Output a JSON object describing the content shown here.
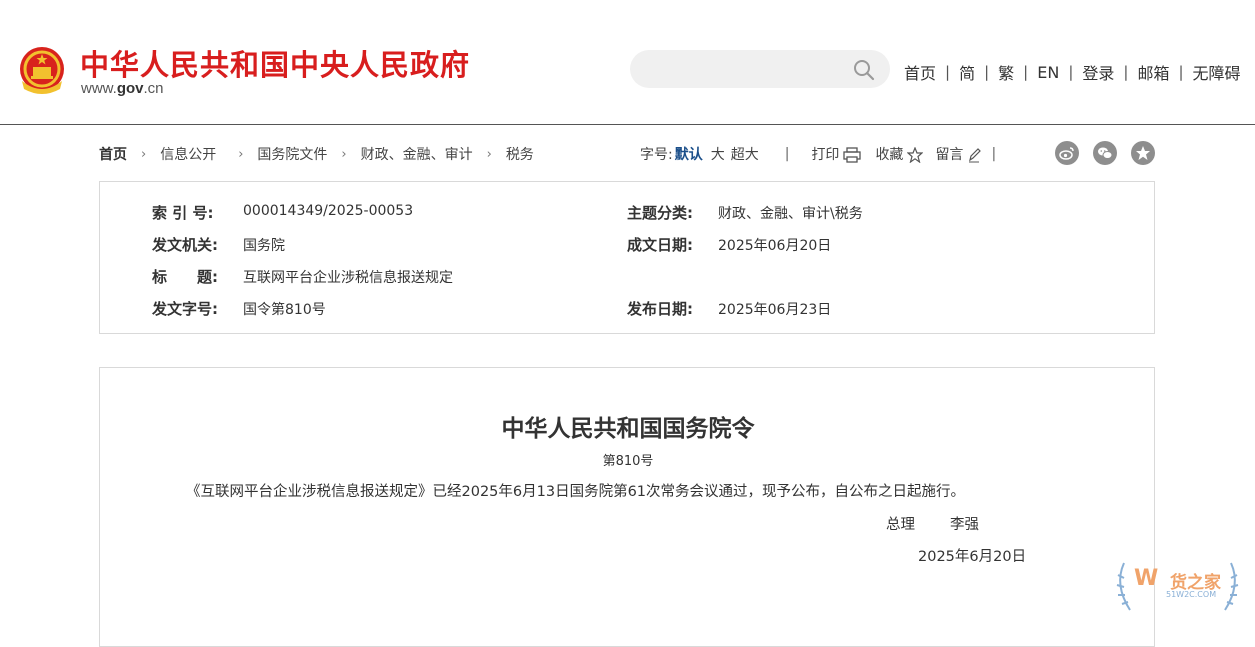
{
  "header": {
    "site_title": "中华人民共和国中央人民政府",
    "domain_prefix": "www.",
    "domain_bold": "gov",
    "domain_suffix": ".cn",
    "search_placeholder": "",
    "nav": [
      "首页",
      "简",
      "繁",
      "EN",
      "登录",
      "邮箱",
      "无障碍"
    ]
  },
  "breadcrumb": [
    "首页",
    "信息公开",
    "国务院文件",
    "财政、金融、审计",
    "税务"
  ],
  "tools": {
    "font_label": "字号:",
    "font_default": "默认",
    "font_large": "大",
    "font_xlarge": "超大",
    "print": "打印",
    "favorite": "收藏",
    "comment": "留言"
  },
  "info": {
    "index_label": "索 引 号:",
    "index_value": "000014349/2025-00053",
    "topic_label": "主题分类:",
    "topic_value": "财政、金融、审计\\税务",
    "issuer_label": "发文机关:",
    "issuer_value": "国务院",
    "created_label": "成文日期:",
    "created_value": "2025年06月20日",
    "title_label": "标　　题:",
    "title_value": "互联网平台企业涉税信息报送规定",
    "docno_label": "发文字号:",
    "docno_value": "国令第810号",
    "published_label": "发布日期:",
    "published_value": "2025年06月23日"
  },
  "document": {
    "title": "中华人民共和国国务院令",
    "number": "第810号",
    "body": "《互联网平台企业涉税信息报送规定》已经2025年6月13日国务院第61次常务会议通过，现予公布，自公布之日起施行。",
    "sign_title": "总理",
    "sign_name": "李强",
    "date": "2025年6月20日"
  },
  "watermark": {
    "text": "货之家",
    "sub": "51W2C.COM"
  },
  "colors": {
    "title_red": "#d81e1e",
    "active_blue": "#1b4f8a",
    "icon_gray": "#8e8e8e"
  }
}
